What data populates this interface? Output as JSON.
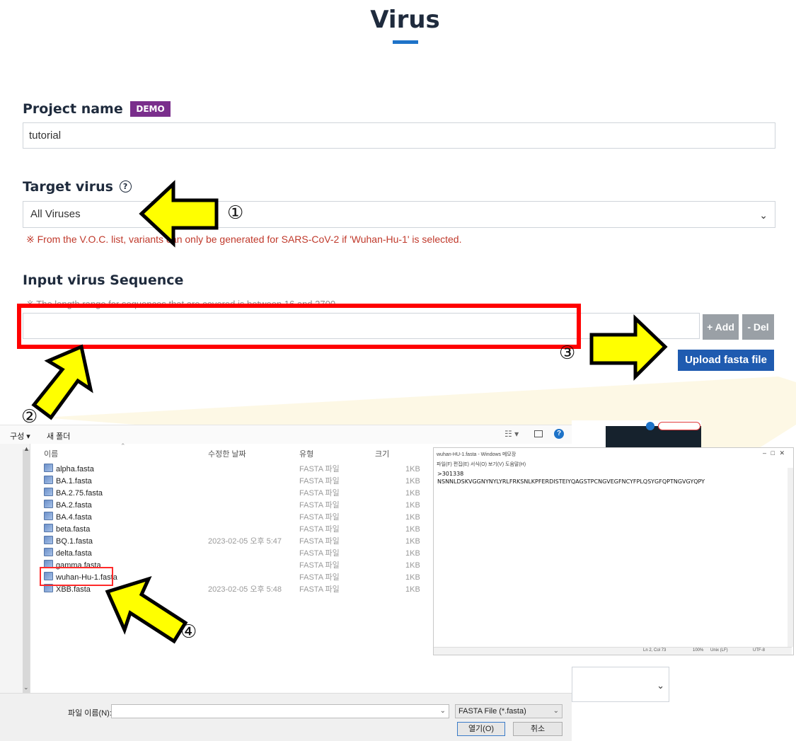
{
  "page": {
    "title": "Virus"
  },
  "project": {
    "label": "Project name",
    "badge": "DEMO",
    "value": "tutorial"
  },
  "target": {
    "label": "Target virus",
    "help_icon": "?",
    "selected": "All Viruses",
    "warning": "※ From the V.O.C. list, variants can only be generated for SARS-CoV-2 if 'Wuhan-Hu-1' is selected."
  },
  "sequence": {
    "label": "Input virus Sequence",
    "note": "※ The length range for sequences that are covered is between 16 and 2700.",
    "value": "",
    "add_label": "+ Add",
    "del_label": "- Del",
    "upload_label": "Upload fasta file"
  },
  "annotations": {
    "step1": "①",
    "step2": "②",
    "step3": "③",
    "step4": "④",
    "arrow_color": "#ffff00",
    "highlight_color": "#ff0000"
  },
  "dialog": {
    "organize": "구성 ▾",
    "new_folder": "새 폴더",
    "columns": {
      "name": "이름",
      "modified": "수정한 날짜",
      "type": "유형",
      "size": "크기"
    },
    "files": [
      {
        "name": "alpha.fasta",
        "modified": "",
        "type": "FASTA 파일",
        "size": "1KB"
      },
      {
        "name": "BA.1.fasta",
        "modified": "",
        "type": "FASTA 파일",
        "size": "1KB"
      },
      {
        "name": "BA.2.75.fasta",
        "modified": "",
        "type": "FASTA 파일",
        "size": "1KB"
      },
      {
        "name": "BA.2.fasta",
        "modified": "",
        "type": "FASTA 파일",
        "size": "1KB"
      },
      {
        "name": "BA.4.fasta",
        "modified": "",
        "type": "FASTA 파일",
        "size": "1KB"
      },
      {
        "name": "beta.fasta",
        "modified": "",
        "type": "FASTA 파일",
        "size": "1KB"
      },
      {
        "name": "BQ.1.fasta",
        "modified": "2023-02-05 오후 5:47",
        "type": "FASTA 파일",
        "size": "1KB"
      },
      {
        "name": "delta.fasta",
        "modified": "",
        "type": "FASTA 파일",
        "size": "1KB"
      },
      {
        "name": "gamma.fasta",
        "modified": "",
        "type": "FASTA 파일",
        "size": "1KB"
      },
      {
        "name": "wuhan-Hu-1.fasta",
        "modified": "",
        "type": "FASTA 파일",
        "size": "1KB"
      },
      {
        "name": "XBB.fasta",
        "modified": "2023-02-05 오후 5:48",
        "type": "FASTA 파일",
        "size": "1KB"
      }
    ],
    "filename_label": "파일 이름(N):",
    "filename_value": "",
    "filter": "FASTA File (*.fasta)",
    "open_label": "열기(O)",
    "cancel_label": "취소"
  },
  "notepad": {
    "title": "wuhan-HU-1.fasta - Windows 메모장",
    "menu": "파일(F)  편집(E)  서식(O)  보기(V)  도움말(H)",
    "line1": ">301338",
    "line2": "NSNNLDSKVGGNYNYLYRLFRKSNLKPFERDISTEIYQAGSTPCNGVEGFNCYFPLQSYGFQPTNGVGYQPY",
    "status_pos": "Ln 2, Col 73",
    "status_zoom": "100%",
    "status_eol": "Unix (LF)",
    "status_enc": "UTF-8",
    "controls": "–   □   ✕"
  }
}
